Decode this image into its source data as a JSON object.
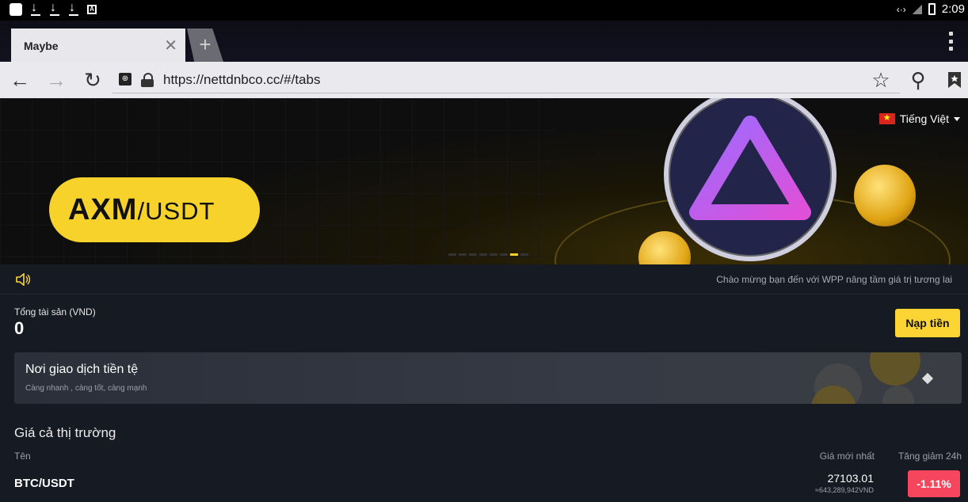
{
  "status_bar": {
    "time": "2:09",
    "left_icons": [
      "app-icon",
      "download-icon",
      "download-icon",
      "download-icon",
      "a-box-icon"
    ],
    "right_icons": [
      "code-arrows-icon",
      "no-signal-icon",
      "battery-icon"
    ]
  },
  "browser": {
    "tab": {
      "title": "Maybe"
    },
    "url": "https://nettdnbco.cc/#/tabs"
  },
  "banner": {
    "pair_main": "AXM",
    "pair_suffix": "/USDT",
    "language": "Tiếng Việt",
    "slides_total": 8,
    "active_slide": 7
  },
  "notice": {
    "message": "Chào mừng bạn đến với WPP nâng tầm giá trị tương lai"
  },
  "asset": {
    "label": "Tổng tài sản (VND)",
    "value": "0",
    "deposit_label": "Nạp tiền"
  },
  "promo_card": {
    "title": "Nơi giao dịch tiền tệ",
    "subtitle": "Càng nhanh , càng tốt, càng mạnh"
  },
  "market": {
    "title": "Giá cả thị trường",
    "col_name": "Tên",
    "col_price": "Giá mới nhất",
    "col_change": "Tăng giảm 24h",
    "rows": [
      {
        "pair": "BTC/USDT",
        "price": "27103.01",
        "vnd": "≈643,289,942VND",
        "change": "-1.11%"
      }
    ]
  },
  "colors": {
    "accent_yellow": "#fcd535",
    "down_red": "#f6465d",
    "panel": "#161a23"
  }
}
